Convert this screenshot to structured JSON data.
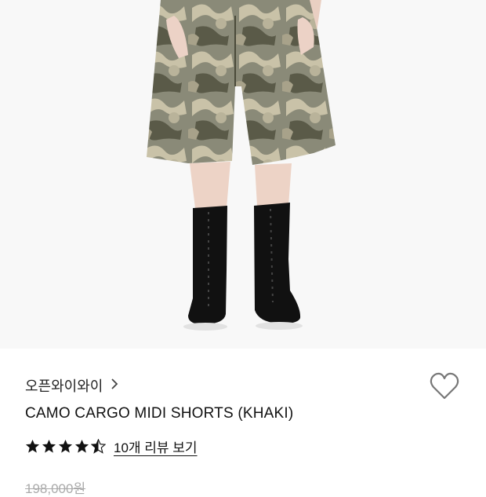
{
  "product": {
    "image_alt": "Model wearing camo cargo midi shorts with black lace-up boots",
    "brand": "오픈와이와이",
    "brand_chevron_icon": "chevron-right-icon",
    "wishlist_icon": "heart-outline-icon",
    "title": "CAMO CARGO MIDI SHORTS (KHAKI)",
    "rating": 4.5,
    "rating_max": 5,
    "review_link": "10개 리뷰 보기",
    "original_price": "198,000원"
  },
  "colors": {
    "star": "#111111",
    "camo_base": "#8a8a78",
    "camo_dark": "#5a5a48",
    "camo_light": "#c9c2a8",
    "boot": "#111111"
  }
}
